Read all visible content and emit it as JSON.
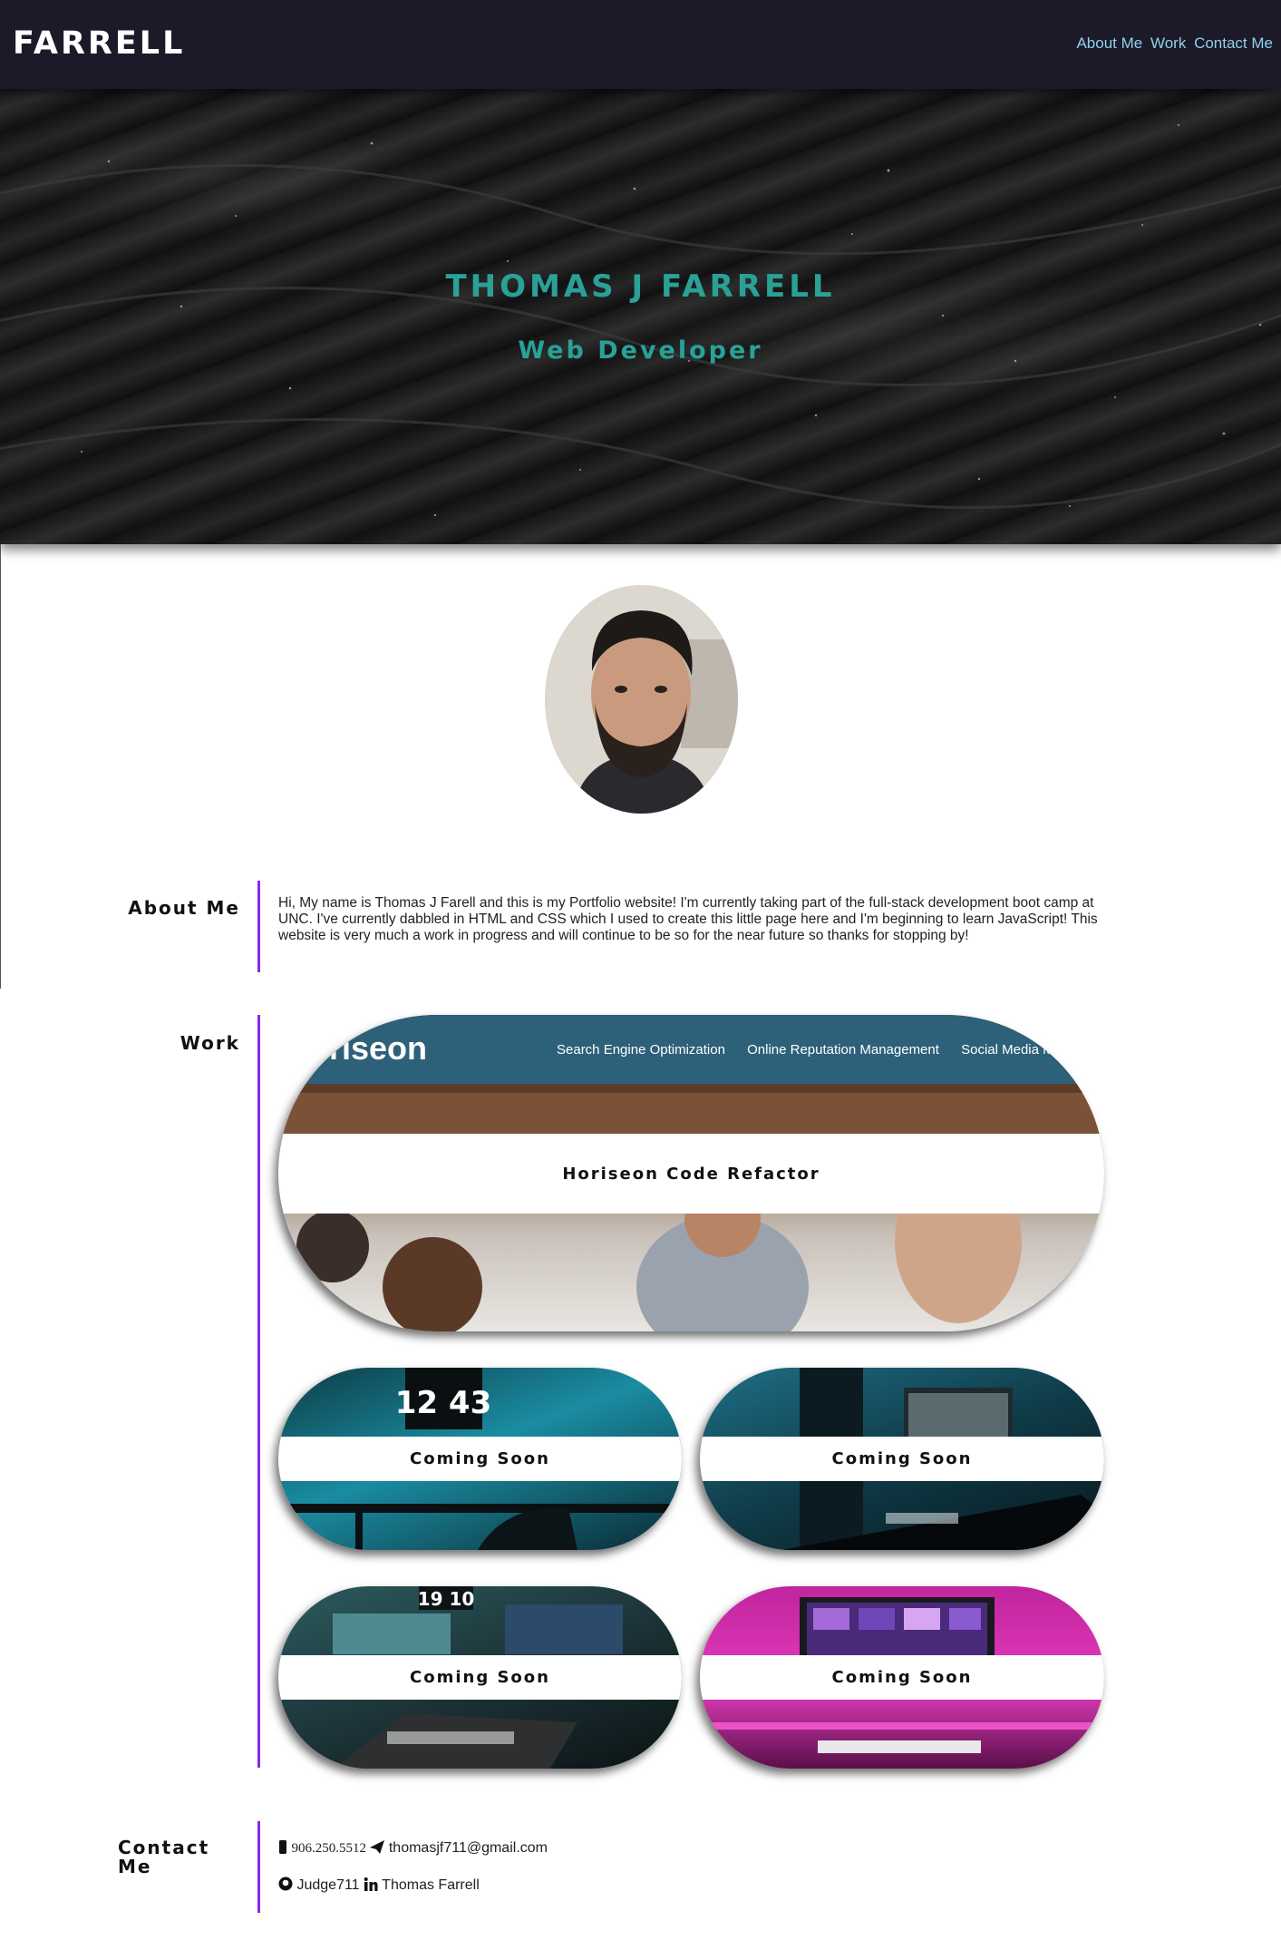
{
  "header": {
    "logo": "FARRELL",
    "nav": [
      {
        "label": "About Me"
      },
      {
        "label": "Work"
      },
      {
        "label": "Contact Me"
      }
    ]
  },
  "hero": {
    "name": "THOMAS J FARRELL",
    "subtitle": "Web Developer"
  },
  "about": {
    "heading": "About Me",
    "text": "Hi, My name is Thomas J Farell and this is my Portfolio website! I'm currently taking part of the full-stack development boot camp at UNC. I've currently dabbled in HTML and CSS which I used to create this little page here and I'm beginning to learn JavaScript! This website is very much a work in progress and will continue to be so for the near future so thanks for stopping by!"
  },
  "work": {
    "heading": "Work",
    "featured": {
      "title": "Horiseon Code Refactor",
      "preview_brand": "oriseon",
      "preview_links": [
        "Search Engine Optimization",
        "Online Reputation Management",
        "Social Media Mar"
      ]
    },
    "projects": [
      {
        "title": "Coming Soon",
        "clock": "12 43"
      },
      {
        "title": "Coming Soon"
      },
      {
        "title": "Coming Soon",
        "clock": "19 10"
      },
      {
        "title": "Coming Soon"
      }
    ]
  },
  "contact": {
    "heading": "Contact Me",
    "phone": "906.250.5512",
    "email": "thomasjf711@gmail.com",
    "github": "Judge711",
    "linkedin": "Thomas Farrell"
  },
  "colors": {
    "header_bg": "#1c1a29",
    "accent_teal": "#2aa197",
    "nav_link": "#8ed0ee",
    "section_rule": "#8a2be2",
    "preview_header": "#2d6079"
  }
}
